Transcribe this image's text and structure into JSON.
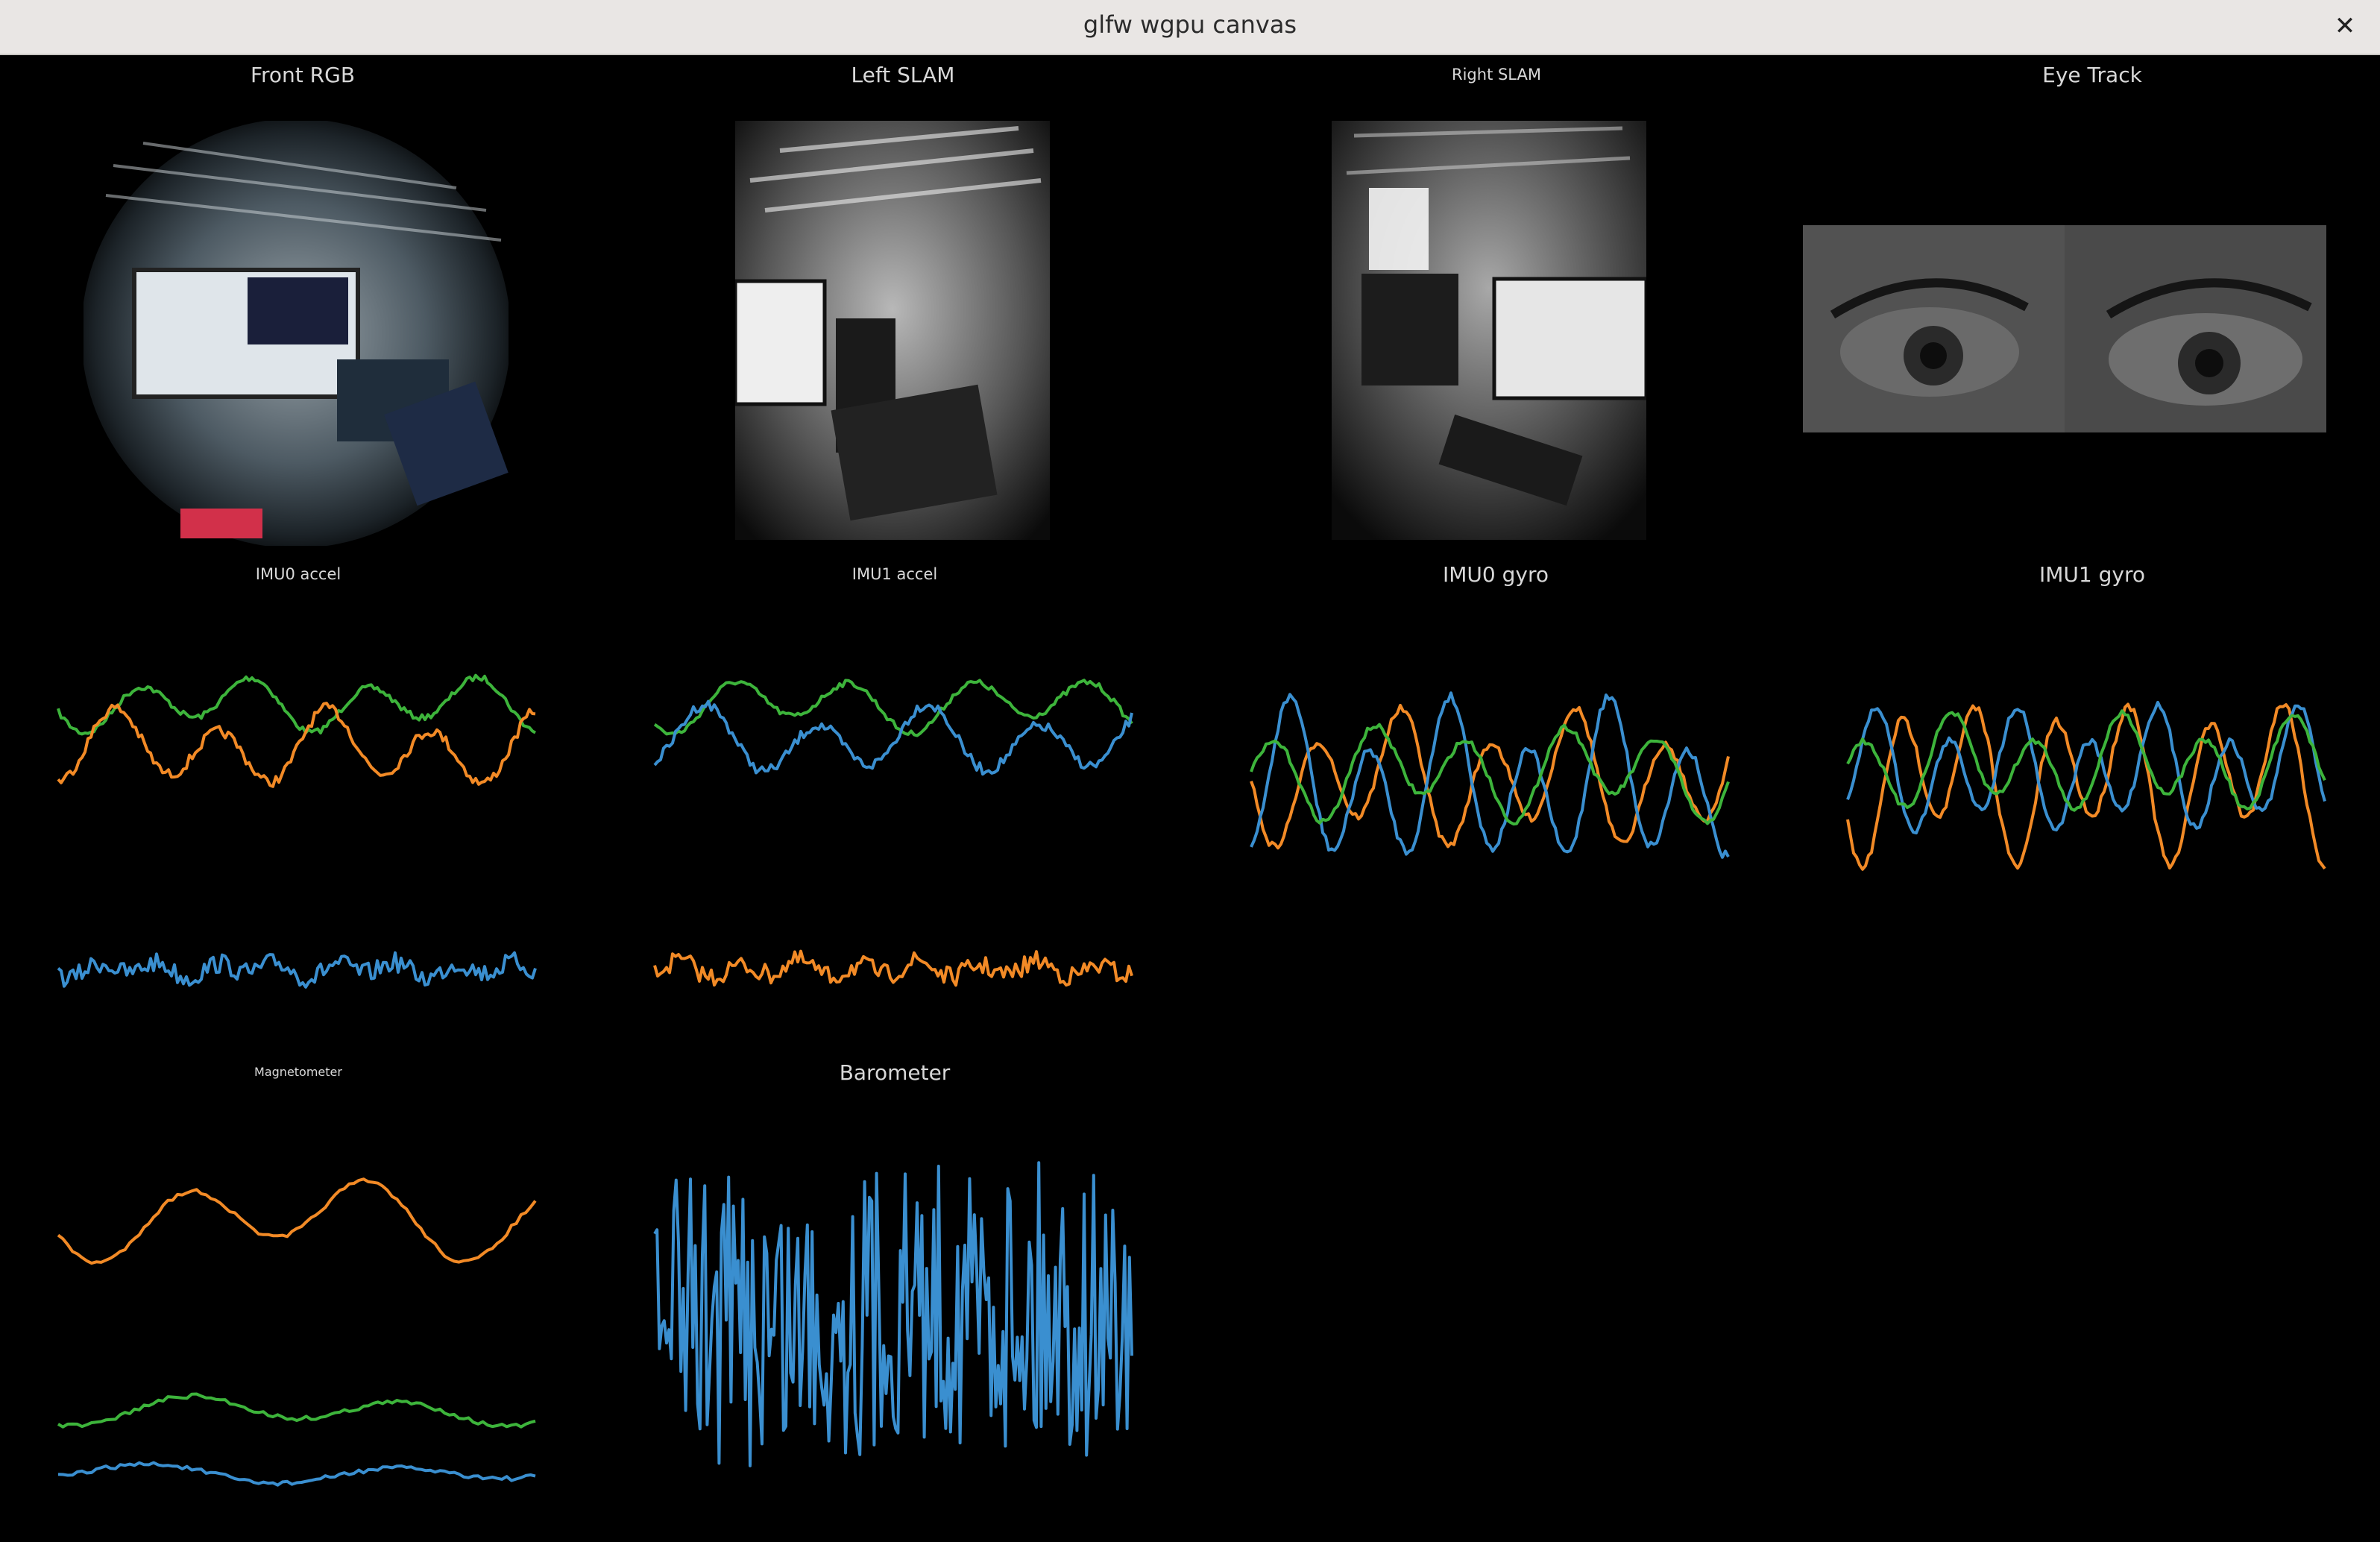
{
  "window": {
    "title": "glfw wgpu canvas",
    "close_glyph": "✕",
    "close_icon": "close-icon"
  },
  "panels": {
    "front_rgb": {
      "title": "Front RGB"
    },
    "left_slam": {
      "title": "Left SLAM"
    },
    "right_slam": {
      "title": "Right SLAM"
    },
    "eye_track": {
      "title": "Eye Track"
    },
    "imu0_accel": {
      "title": "IMU0 accel"
    },
    "imu1_accel": {
      "title": "IMU1 accel"
    },
    "imu0_gyro": {
      "title": "IMU0 gyro"
    },
    "imu1_gyro": {
      "title": "IMU1 gyro"
    },
    "magnetometer": {
      "title": "Magnetometer"
    },
    "barometer": {
      "title": "Barometer"
    }
  },
  "colors": {
    "blue": "#3a8fd0",
    "orange": "#f28a26",
    "green": "#3db43b"
  }
}
